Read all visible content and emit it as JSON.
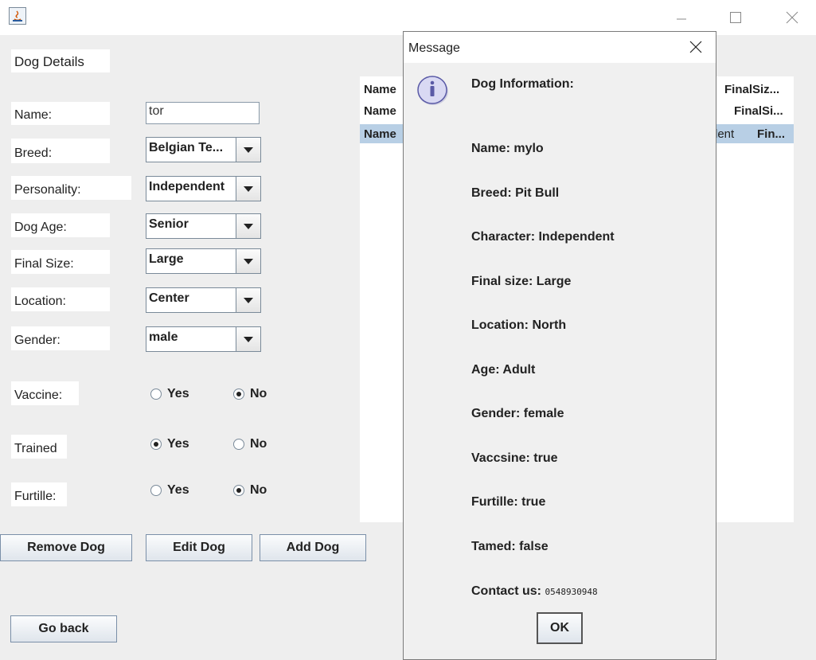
{
  "window": {
    "app_icon": "java-icon",
    "minimize_icon": "minimize-icon",
    "maximize_icon": "maximize-icon",
    "close_icon": "close-icon"
  },
  "form": {
    "header": "Dog Details",
    "name_label": "Name:",
    "name_value": "tor",
    "breed_label": "Breed:",
    "breed_value": "Belgian Te...",
    "personality_label": "Personality:",
    "personality_value": "Independent",
    "age_label": "Dog Age:",
    "age_value": "Senior",
    "size_label": "Final Size:",
    "size_value": "Large",
    "location_label": "Location:",
    "location_value": "Center",
    "gender_label": "Gender:",
    "gender_value": "male",
    "vaccine_label": "Vaccine:",
    "trained_label": "Trained",
    "furtille_label": "Furtille:",
    "yes": "Yes",
    "no": "No",
    "vaccine_selected": "No",
    "trained_selected": "Yes",
    "furtille_selected": "No"
  },
  "buttons": {
    "remove": "Remove Dog",
    "edit": "Edit Dog",
    "add": "Add Dog",
    "back": "Go back"
  },
  "table": {
    "rows": [
      {
        "left": "Name",
        "right": "FinalSiz..."
      },
      {
        "left": "Name",
        "right": "FinalSi..."
      },
      {
        "left": "Name",
        "right_mid": "lent",
        "right": "Fin..."
      }
    ],
    "selected_row": 2
  },
  "dialog": {
    "title": "Message",
    "close_icon": "close-icon",
    "info_icon": "info-icon",
    "heading": "Dog Information:",
    "lines": {
      "name": "Name: mylo",
      "breed": "Breed: Pit Bull",
      "character": "Character: Independent",
      "size": "Final size: Large",
      "location": "Location: North",
      "age": "Age: Adult",
      "gender": "Gender: female",
      "vaccine": "Vaccsine: true",
      "furtille": "Furtille: true",
      "tamed": "Tamed: false",
      "contact_label": "Contact us: ",
      "contact_number": "0548930948"
    },
    "ok": "OK"
  }
}
